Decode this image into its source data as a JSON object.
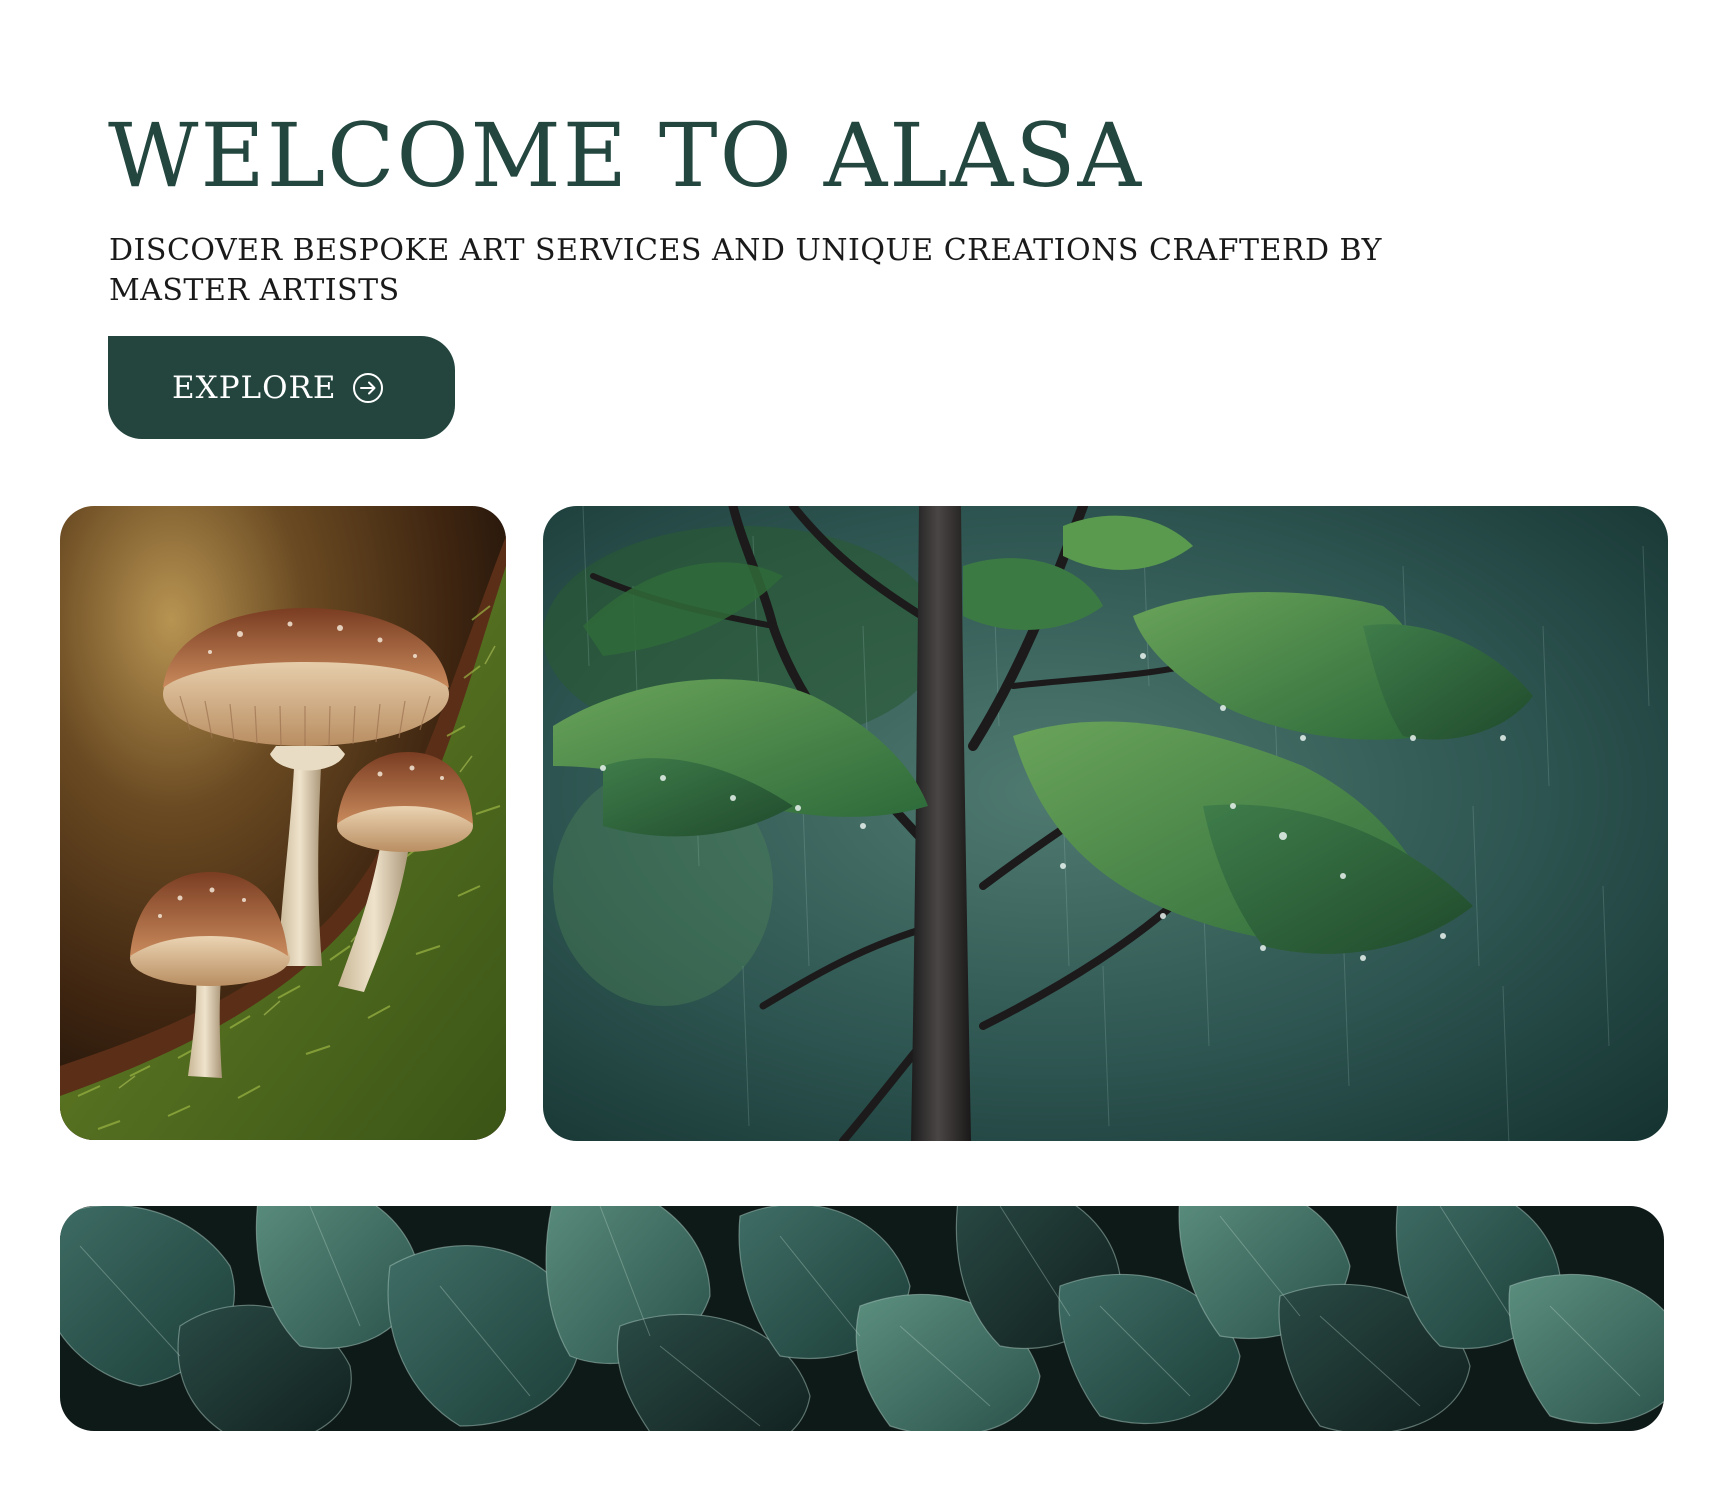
{
  "hero": {
    "title": "WELCOME TO ALASA",
    "subtitle": "DISCOVER BESPOKE ART SERVICES AND UNIQUE CREATIONS CRAFTERD BY MASTER ARTISTS",
    "cta_label": "EXPLORE",
    "cta_icon": "arrow-circle-right-icon"
  },
  "gallery": {
    "images": [
      {
        "subject": "painting of brown mushrooms on a mossy log"
      },
      {
        "subject": "young tree with wet green leaves in rain"
      },
      {
        "subject": "dark green painted leaves pattern"
      }
    ]
  },
  "colors": {
    "brand": "#23453d",
    "title": "#23463f",
    "text": "#1a1a1a",
    "background": "#ffffff"
  }
}
